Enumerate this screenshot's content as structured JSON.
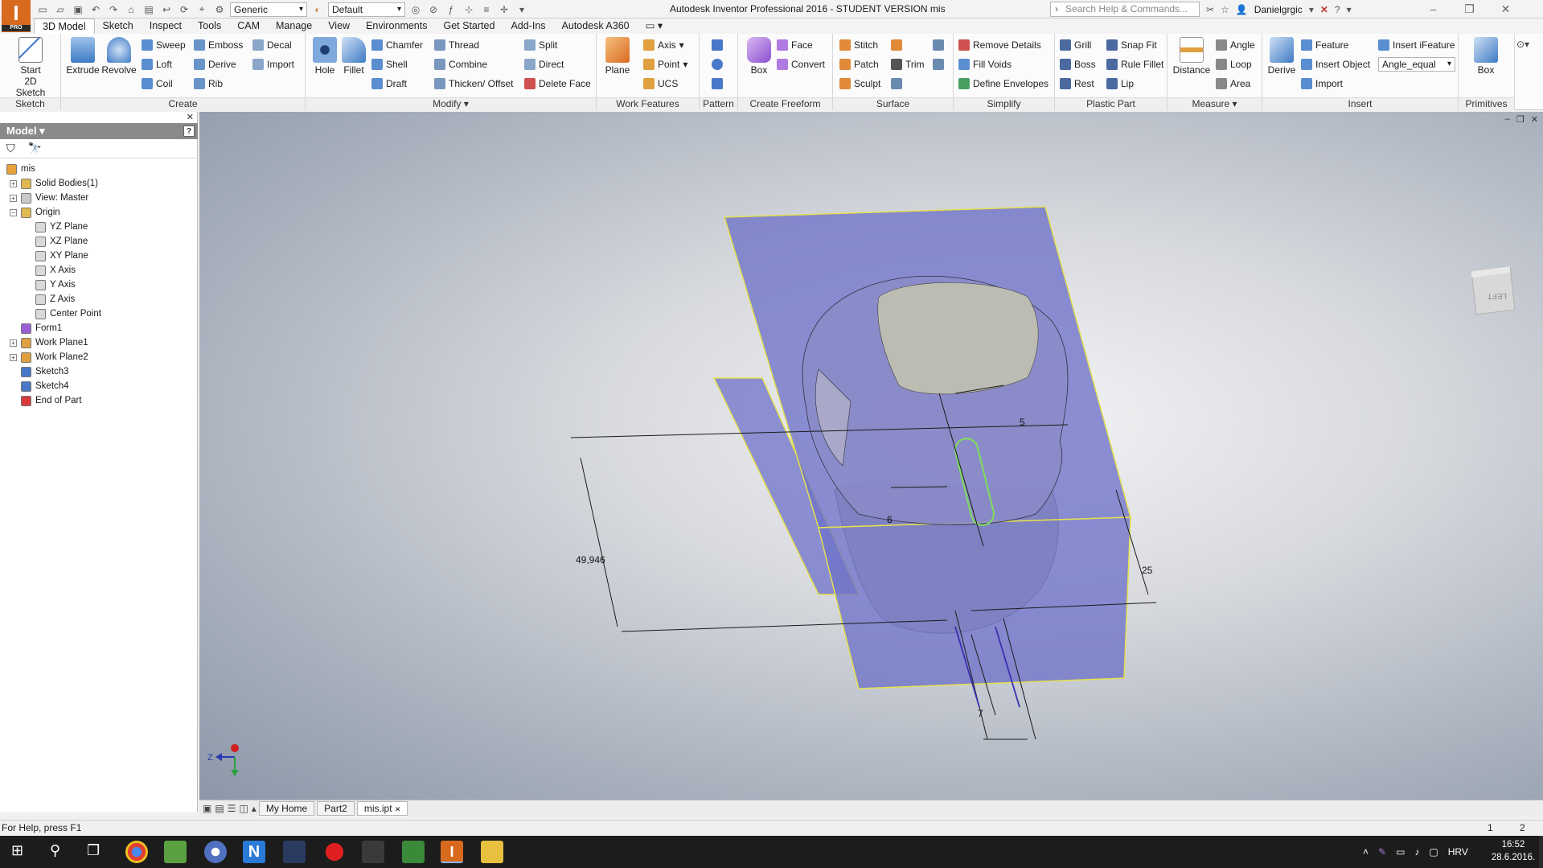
{
  "titlebar": {
    "app_title": "Autodesk Inventor Professional 2016 - STUDENT VERSION   mis",
    "logo_letter": "I",
    "logo_badge": "PRO",
    "appearance_combo": "Generic",
    "color_combo": "Default",
    "search_placeholder": "Search Help & Commands...",
    "user": "Danielgrgic"
  },
  "ribbon_tabs": [
    "3D Model",
    "Sketch",
    "Inspect",
    "Tools",
    "CAM",
    "Manage",
    "View",
    "Environments",
    "Get Started",
    "Add-Ins",
    "Autodesk A360"
  ],
  "ribbon": {
    "sketch": {
      "title": "Sketch",
      "start_label": "Start",
      "start_label2": "2D Sketch"
    },
    "create": {
      "title": "Create",
      "extrude": "Extrude",
      "revolve": "Revolve",
      "sweep": "Sweep",
      "loft": "Loft",
      "coil": "Coil",
      "emboss": "Emboss",
      "derive": "Derive",
      "rib": "Rib",
      "decal": "Decal",
      "import": "Import"
    },
    "modify": {
      "title": "Modify",
      "hole": "Hole",
      "fillet": "Fillet",
      "chamfer": "Chamfer",
      "shell": "Shell",
      "draft": "Draft",
      "thread": "Thread",
      "combine": "Combine",
      "thicken": "Thicken/ Offset",
      "split": "Split",
      "direct": "Direct",
      "delete_face": "Delete Face"
    },
    "work_features": {
      "title": "Work Features",
      "plane": "Plane",
      "axis": "Axis",
      "point": "Point",
      "ucs": "UCS"
    },
    "pattern": {
      "title": "Pattern"
    },
    "freeform": {
      "title": "Create Freeform",
      "box": "Box",
      "face": "Face",
      "convert": "Convert"
    },
    "surface": {
      "title": "Surface",
      "stitch": "Stitch",
      "patch": "Patch",
      "sculpt": "Sculpt",
      "trim": "Trim"
    },
    "simplify": {
      "title": "Simplify",
      "remove_details": "Remove Details",
      "fill_voids": "Fill Voids",
      "define_envelopes": "Define Envelopes"
    },
    "plastic": {
      "title": "Plastic Part",
      "grill": "Grill",
      "boss": "Boss",
      "rest": "Rest",
      "snap_fit": "Snap Fit",
      "rule_fillet": "Rule Fillet",
      "lip": "Lip"
    },
    "measure": {
      "title": "Measure",
      "distance": "Distance",
      "angle": "Angle",
      "loop": "Loop",
      "area": "Area"
    },
    "insert": {
      "title": "Insert",
      "derive": "Derive",
      "feature": "Feature",
      "insert_object": "Insert Object",
      "import": "Import",
      "insert_ifeature": "Insert iFeature",
      "angle_combo": "Angle_equal"
    },
    "primitives": {
      "title": "Primitives",
      "box": "Box"
    }
  },
  "browser": {
    "title": "Model",
    "items": [
      {
        "label": "mis",
        "level": 0,
        "icon": "part-icon",
        "color": "#e8a23a"
      },
      {
        "label": "Solid Bodies(1)",
        "level": 1,
        "icon": "folder-icon",
        "color": "#e0b850"
      },
      {
        "label": "View: Master",
        "level": 1,
        "icon": "view-icon",
        "color": "#c9c9c9"
      },
      {
        "label": "Origin",
        "level": 1,
        "icon": "folder-icon",
        "color": "#e0b850"
      },
      {
        "label": "YZ Plane",
        "level": 2,
        "icon": "plane-icon",
        "color": "#d9d9d9"
      },
      {
        "label": "XZ Plane",
        "level": 2,
        "icon": "plane-icon",
        "color": "#d9d9d9"
      },
      {
        "label": "XY Plane",
        "level": 2,
        "icon": "plane-icon",
        "color": "#d9d9d9"
      },
      {
        "label": "X Axis",
        "level": 2,
        "icon": "axis-icon",
        "color": "#d9d9d9"
      },
      {
        "label": "Y Axis",
        "level": 2,
        "icon": "axis-icon",
        "color": "#d9d9d9"
      },
      {
        "label": "Z Axis",
        "level": 2,
        "icon": "axis-icon",
        "color": "#d9d9d9"
      },
      {
        "label": "Center Point",
        "level": 2,
        "icon": "point-icon",
        "color": "#d9d9d9"
      },
      {
        "label": "Form1",
        "level": 1,
        "icon": "freeform-icon",
        "color": "#9a5dd6"
      },
      {
        "label": "Work Plane1",
        "level": 1,
        "icon": "workplane-icon",
        "color": "#e0a040"
      },
      {
        "label": "Work Plane2",
        "level": 1,
        "icon": "workplane-icon",
        "color": "#e0a040"
      },
      {
        "label": "Sketch3",
        "level": 1,
        "icon": "sketch-icon",
        "color": "#4a78c8"
      },
      {
        "label": "Sketch4",
        "level": 1,
        "icon": "sketch-icon",
        "color": "#4a78c8"
      },
      {
        "label": "End of Part",
        "level": 1,
        "icon": "end-of-part-icon",
        "color": "#d83a3a"
      }
    ]
  },
  "viewport": {
    "dimensions": {
      "d1": "5",
      "d2": "6",
      "d3": "49,946",
      "d4": "25",
      "d5": "7"
    },
    "viewcube_label": "LEFT",
    "triad": {
      "z": "Z",
      "y": "Y",
      "x": "X"
    }
  },
  "doc_tabs": [
    "My Home",
    "Part2",
    "mis.ipt"
  ],
  "status": {
    "help": "For Help, press F1",
    "n1": "1",
    "n2": "2"
  },
  "taskbar": {
    "lang": "HRV",
    "time": "16:52",
    "date": "28.6.2016."
  },
  "colors": {
    "accent": "#d86a1e",
    "plane_fill": "#6e72c8",
    "plane_edge": "#e6e050",
    "sketch_green": "#7ee05a"
  }
}
